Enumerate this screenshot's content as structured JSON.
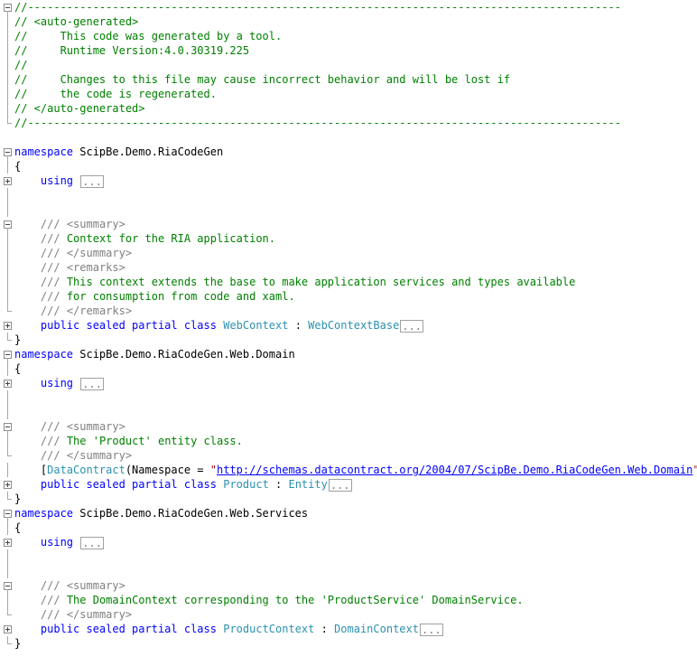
{
  "code_lines": [
    {
      "fold": "minus",
      "segs": [
        {
          "c": "c",
          "t": "//-------------------------------------------------------------------------------------------"
        }
      ]
    },
    {
      "fold": "bar",
      "segs": [
        {
          "c": "c",
          "t": "// <auto-generated>"
        }
      ]
    },
    {
      "fold": "bar",
      "segs": [
        {
          "c": "c",
          "t": "//     This code was generated by a tool."
        }
      ]
    },
    {
      "fold": "bar",
      "segs": [
        {
          "c": "c",
          "t": "//     Runtime Version:4.0.30319.225"
        }
      ]
    },
    {
      "fold": "bar",
      "segs": [
        {
          "c": "c",
          "t": "//"
        }
      ]
    },
    {
      "fold": "bar",
      "segs": [
        {
          "c": "c",
          "t": "//     Changes to this file may cause incorrect behavior and will be lost if"
        }
      ]
    },
    {
      "fold": "bar",
      "segs": [
        {
          "c": "c",
          "t": "//     the code is regenerated."
        }
      ]
    },
    {
      "fold": "bar",
      "segs": [
        {
          "c": "c",
          "t": "// </auto-generated>"
        }
      ]
    },
    {
      "fold": "end",
      "segs": [
        {
          "c": "c",
          "t": "//-------------------------------------------------------------------------------------------"
        }
      ]
    },
    {
      "fold": "none",
      "segs": []
    },
    {
      "fold": "minus",
      "segs": [
        {
          "c": "k",
          "t": "namespace"
        },
        {
          "c": "p",
          "t": " ScipBe.Demo.RiaCodeGen"
        }
      ]
    },
    {
      "fold": "bar",
      "segs": [
        {
          "c": "p",
          "t": "{"
        }
      ]
    },
    {
      "fold": "plus",
      "segs": [
        {
          "c": "p",
          "t": "    "
        },
        {
          "c": "k",
          "t": "using"
        },
        {
          "c": "p",
          "t": " "
        },
        {
          "c": "e",
          "t": "..."
        }
      ]
    },
    {
      "fold": "bar",
      "segs": []
    },
    {
      "fold": "bar",
      "segs": []
    },
    {
      "fold": "minus",
      "segs": [
        {
          "c": "p",
          "t": "    "
        },
        {
          "c": "x",
          "t": "///"
        },
        {
          "c": "c",
          "t": " "
        },
        {
          "c": "x",
          "t": "<summary>"
        }
      ]
    },
    {
      "fold": "bar",
      "segs": [
        {
          "c": "p",
          "t": "    "
        },
        {
          "c": "x",
          "t": "///"
        },
        {
          "c": "c",
          "t": " Context for the RIA application."
        }
      ]
    },
    {
      "fold": "bar",
      "segs": [
        {
          "c": "p",
          "t": "    "
        },
        {
          "c": "x",
          "t": "///"
        },
        {
          "c": "c",
          "t": " "
        },
        {
          "c": "x",
          "t": "</summary>"
        }
      ]
    },
    {
      "fold": "bar",
      "segs": [
        {
          "c": "p",
          "t": "    "
        },
        {
          "c": "x",
          "t": "///"
        },
        {
          "c": "c",
          "t": " "
        },
        {
          "c": "x",
          "t": "<remarks>"
        }
      ]
    },
    {
      "fold": "bar",
      "segs": [
        {
          "c": "p",
          "t": "    "
        },
        {
          "c": "x",
          "t": "///"
        },
        {
          "c": "c",
          "t": " This context extends the base to make application services and types available"
        }
      ]
    },
    {
      "fold": "bar",
      "segs": [
        {
          "c": "p",
          "t": "    "
        },
        {
          "c": "x",
          "t": "///"
        },
        {
          "c": "c",
          "t": " for consumption from code and xaml."
        }
      ]
    },
    {
      "fold": "end",
      "segs": [
        {
          "c": "p",
          "t": "    "
        },
        {
          "c": "x",
          "t": "///"
        },
        {
          "c": "c",
          "t": " "
        },
        {
          "c": "x",
          "t": "</remarks>"
        }
      ]
    },
    {
      "fold": "plus",
      "segs": [
        {
          "c": "p",
          "t": "    "
        },
        {
          "c": "k",
          "t": "public sealed partial class"
        },
        {
          "c": "p",
          "t": " "
        },
        {
          "c": "t",
          "t": "WebContext"
        },
        {
          "c": "p",
          "t": " : "
        },
        {
          "c": "t",
          "t": "WebContextBase"
        },
        {
          "c": "e",
          "t": "..."
        }
      ]
    },
    {
      "fold": "end",
      "segs": [
        {
          "c": "p",
          "t": "}"
        }
      ]
    },
    {
      "fold": "minus",
      "segs": [
        {
          "c": "k",
          "t": "namespace"
        },
        {
          "c": "p",
          "t": " ScipBe.Demo.RiaCodeGen.Web.Domain"
        }
      ]
    },
    {
      "fold": "bar",
      "segs": [
        {
          "c": "p",
          "t": "{"
        }
      ]
    },
    {
      "fold": "plus",
      "segs": [
        {
          "c": "p",
          "t": "    "
        },
        {
          "c": "k",
          "t": "using"
        },
        {
          "c": "p",
          "t": " "
        },
        {
          "c": "e",
          "t": "..."
        }
      ]
    },
    {
      "fold": "bar",
      "segs": []
    },
    {
      "fold": "bar",
      "segs": []
    },
    {
      "fold": "minus",
      "segs": [
        {
          "c": "p",
          "t": "    "
        },
        {
          "c": "x",
          "t": "///"
        },
        {
          "c": "c",
          "t": " "
        },
        {
          "c": "x",
          "t": "<summary>"
        }
      ]
    },
    {
      "fold": "bar",
      "segs": [
        {
          "c": "p",
          "t": "    "
        },
        {
          "c": "x",
          "t": "///"
        },
        {
          "c": "c",
          "t": " The 'Product' entity class."
        }
      ]
    },
    {
      "fold": "end",
      "segs": [
        {
          "c": "p",
          "t": "    "
        },
        {
          "c": "x",
          "t": "///"
        },
        {
          "c": "c",
          "t": " "
        },
        {
          "c": "x",
          "t": "</summary>"
        }
      ]
    },
    {
      "fold": "bar",
      "segs": [
        {
          "c": "p",
          "t": "    ["
        },
        {
          "c": "t",
          "t": "DataContract"
        },
        {
          "c": "p",
          "t": "(Namespace = "
        },
        {
          "c": "s",
          "t": "\""
        },
        {
          "c": "u",
          "t": "http://schemas.datacontract.org/2004/07/ScipBe.Demo.RiaCodeGen.Web.Domain"
        },
        {
          "c": "s",
          "t": "\""
        },
        {
          "c": "p",
          "t": ")]"
        }
      ]
    },
    {
      "fold": "plus",
      "segs": [
        {
          "c": "p",
          "t": "    "
        },
        {
          "c": "k",
          "t": "public sealed partial class"
        },
        {
          "c": "p",
          "t": " "
        },
        {
          "c": "t",
          "t": "Product"
        },
        {
          "c": "p",
          "t": " : "
        },
        {
          "c": "t",
          "t": "Entity"
        },
        {
          "c": "e",
          "t": "..."
        }
      ]
    },
    {
      "fold": "end",
      "segs": [
        {
          "c": "p",
          "t": "}"
        }
      ]
    },
    {
      "fold": "minus",
      "segs": [
        {
          "c": "k",
          "t": "namespace"
        },
        {
          "c": "p",
          "t": " ScipBe.Demo.RiaCodeGen.Web.Services"
        }
      ]
    },
    {
      "fold": "bar",
      "segs": [
        {
          "c": "p",
          "t": "{"
        }
      ]
    },
    {
      "fold": "plus",
      "segs": [
        {
          "c": "p",
          "t": "    "
        },
        {
          "c": "k",
          "t": "using"
        },
        {
          "c": "p",
          "t": " "
        },
        {
          "c": "e",
          "t": "..."
        }
      ]
    },
    {
      "fold": "bar",
      "segs": []
    },
    {
      "fold": "bar",
      "segs": []
    },
    {
      "fold": "minus",
      "segs": [
        {
          "c": "p",
          "t": "    "
        },
        {
          "c": "x",
          "t": "///"
        },
        {
          "c": "c",
          "t": " "
        },
        {
          "c": "x",
          "t": "<summary>"
        }
      ]
    },
    {
      "fold": "bar",
      "segs": [
        {
          "c": "p",
          "t": "    "
        },
        {
          "c": "x",
          "t": "///"
        },
        {
          "c": "c",
          "t": " The DomainContext corresponding to the 'ProductService' DomainService."
        }
      ]
    },
    {
      "fold": "end",
      "segs": [
        {
          "c": "p",
          "t": "    "
        },
        {
          "c": "x",
          "t": "///"
        },
        {
          "c": "c",
          "t": " "
        },
        {
          "c": "x",
          "t": "</summary>"
        }
      ]
    },
    {
      "fold": "plus",
      "segs": [
        {
          "c": "p",
          "t": "    "
        },
        {
          "c": "k",
          "t": "public sealed partial class"
        },
        {
          "c": "p",
          "t": " "
        },
        {
          "c": "t",
          "t": "ProductContext"
        },
        {
          "c": "p",
          "t": " : "
        },
        {
          "c": "t",
          "t": "DomainContext"
        },
        {
          "c": "e",
          "t": "..."
        }
      ]
    },
    {
      "fold": "end",
      "segs": [
        {
          "c": "p",
          "t": "}"
        }
      ]
    }
  ]
}
